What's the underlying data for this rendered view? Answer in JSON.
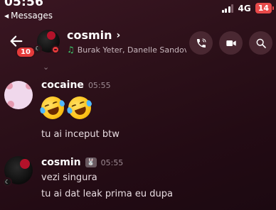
{
  "status_bar": {
    "time": "05:56",
    "back_app": "Messages",
    "network": "4G",
    "battery": "14"
  },
  "header": {
    "name": "cosmin",
    "subtitle": "Burak Yeter, Danelle Sandov...",
    "unread_count": "10",
    "buttons": [
      "phone-call",
      "video-call",
      "search"
    ]
  },
  "messages": [
    {
      "author": "cocaine",
      "time": "05:55",
      "emoji_count": 2,
      "text": "tu ai inceput btw"
    },
    {
      "author": "cosmin",
      "time": "05:55",
      "lines": [
        "vezi singura",
        "tu ai dat leak prima eu dupa"
      ]
    }
  ],
  "colors": {
    "background": "#2c1019",
    "dnd": "#e63b3b",
    "music": "#3bd16f",
    "battery_low": "#e84a4a"
  }
}
